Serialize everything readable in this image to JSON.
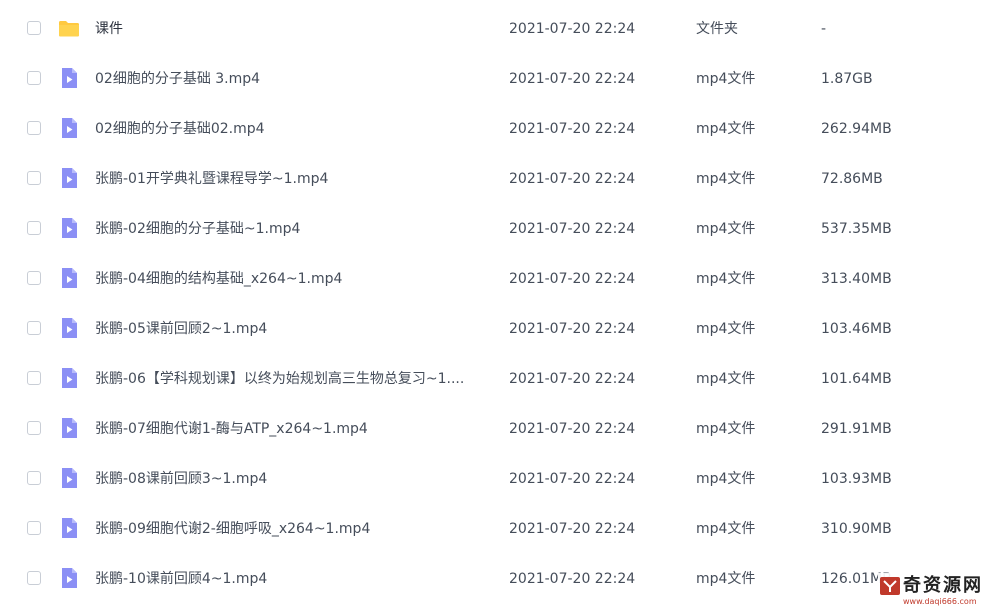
{
  "colors": {
    "folder": "#ffc940",
    "video_icon": "#8b8ff5",
    "text": "#454d5a",
    "watermark_red": "#c0392b"
  },
  "files": [
    {
      "name": "课件",
      "date": "2021-07-20 22:24",
      "type": "文件夹",
      "size": "-",
      "icon": "folder-icon"
    },
    {
      "name": "02细胞的分子基础 3.mp4",
      "date": "2021-07-20 22:24",
      "type": "mp4文件",
      "size": "1.87GB",
      "icon": "video-file-icon"
    },
    {
      "name": "02细胞的分子基础02.mp4",
      "date": "2021-07-20 22:24",
      "type": "mp4文件",
      "size": "262.94MB",
      "icon": "video-file-icon"
    },
    {
      "name": "张鹏-01开学典礼暨课程导学~1.mp4",
      "date": "2021-07-20 22:24",
      "type": "mp4文件",
      "size": "72.86MB",
      "icon": "video-file-icon"
    },
    {
      "name": "张鹏-02细胞的分子基础~1.mp4",
      "date": "2021-07-20 22:24",
      "type": "mp4文件",
      "size": "537.35MB",
      "icon": "video-file-icon"
    },
    {
      "name": "张鹏-04细胞的结构基础_x264~1.mp4",
      "date": "2021-07-20 22:24",
      "type": "mp4文件",
      "size": "313.40MB",
      "icon": "video-file-icon"
    },
    {
      "name": "张鹏-05课前回顾2~1.mp4",
      "date": "2021-07-20 22:24",
      "type": "mp4文件",
      "size": "103.46MB",
      "icon": "video-file-icon"
    },
    {
      "name": "张鹏-06【学科规划课】以终为始规划高三生物总复习~1....",
      "date": "2021-07-20 22:24",
      "type": "mp4文件",
      "size": "101.64MB",
      "icon": "video-file-icon"
    },
    {
      "name": "张鹏-07细胞代谢1-酶与ATP_x264~1.mp4",
      "date": "2021-07-20 22:24",
      "type": "mp4文件",
      "size": "291.91MB",
      "icon": "video-file-icon"
    },
    {
      "name": "张鹏-08课前回顾3~1.mp4",
      "date": "2021-07-20 22:24",
      "type": "mp4文件",
      "size": "103.93MB",
      "icon": "video-file-icon"
    },
    {
      "name": "张鹏-09细胞代谢2-细胞呼吸_x264~1.mp4",
      "date": "2021-07-20 22:24",
      "type": "mp4文件",
      "size": "310.90MB",
      "icon": "video-file-icon"
    },
    {
      "name": "张鹏-10课前回顾4~1.mp4",
      "date": "2021-07-20 22:24",
      "type": "mp4文件",
      "size": "126.01MB",
      "icon": "video-file-icon"
    }
  ],
  "watermark": {
    "title": "奇资源网",
    "url": "www.daqi666.com"
  }
}
